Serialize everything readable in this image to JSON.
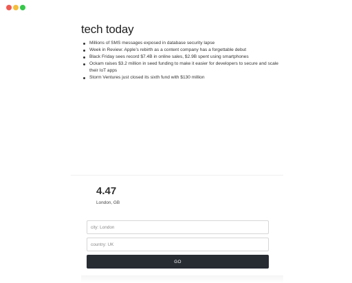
{
  "window": {
    "controls": [
      "close-icon",
      "minimize-icon",
      "maximize-icon"
    ],
    "colors": {
      "close": "#ee5a52",
      "minimize": "#f5bd3a",
      "maximize": "#35c84a"
    }
  },
  "news": {
    "title": "tech today",
    "items": [
      "Millions of SMS messages exposed in database security lapse",
      "Week in Review: Apple’s rebirth as a content company has a forgettable debut",
      "Black Friday sees record $7.4B in online sales, $2.9B spent using smartphones",
      "Ockam raises $3.2 million in seed funding to make it easier for developers to secure and scale their IoT apps",
      "Storm Ventures just closed its sixth fund with $130 million"
    ]
  },
  "weather": {
    "temperature": "4.47",
    "location": "London, GB"
  },
  "form": {
    "city_placeholder": "city: London",
    "country_placeholder": "country: UK",
    "button_label": "GO",
    "button_color": "#272c33"
  }
}
